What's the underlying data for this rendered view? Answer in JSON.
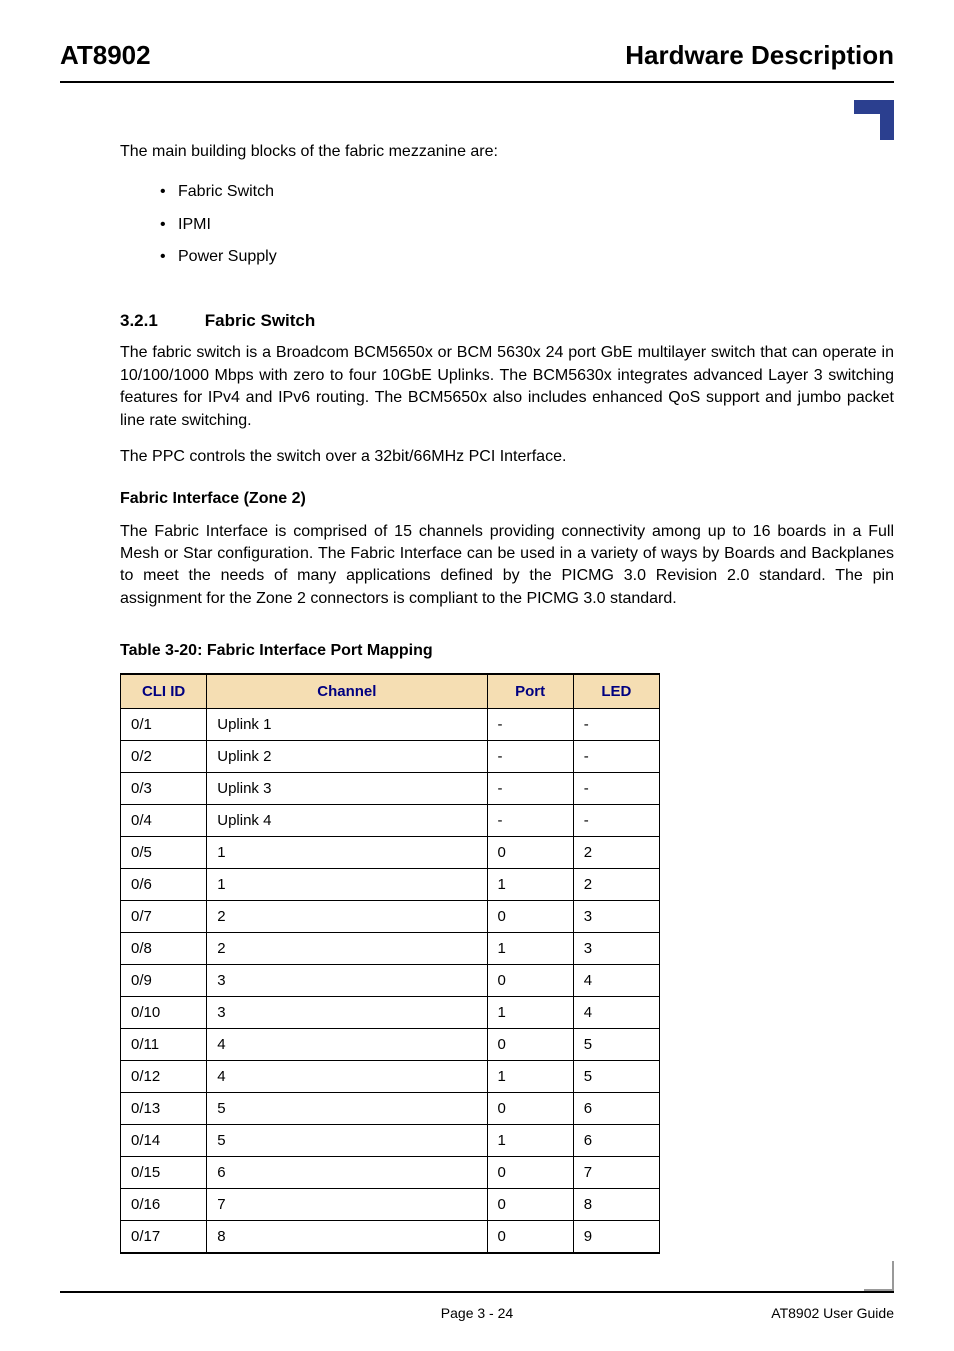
{
  "header": {
    "left": "AT8902",
    "right": "Hardware Description"
  },
  "intro": "The main building blocks of the fabric mezzanine are:",
  "bullets": {
    "b0": "Fabric Switch",
    "b1": "IPMI",
    "b2": "Power Supply"
  },
  "section": {
    "num": "3.2.1",
    "title": "Fabric Switch",
    "p1": "The fabric switch is a Broadcom BCM5650x or BCM 5630x 24 port GbE multilayer switch that can operate in 10/100/1000 Mbps with zero to four 10GbE Uplinks. The BCM5630x integrates advanced Layer 3 switching features for IPv4 and IPv6 routing. The BCM5650x also includes enhanced QoS support and jumbo packet line rate switching.",
    "p2": "The PPC controls the switch over a 32bit/66MHz PCI Interface."
  },
  "subsection": {
    "title": "Fabric Interface (Zone 2)",
    "p1": "The Fabric Interface is comprised of 15 channels providing connectivity among up to 16 boards in a Full Mesh or Star configuration. The Fabric Interface can be used in a variety of ways by Boards and Backplanes to meet the needs of many applications defined by the PICMG 3.0 Revision 2.0 standard. The pin assignment for the Zone 2 connectors is compliant to the PICMG 3.0 standard."
  },
  "table": {
    "caption": "Table 3-20:  Fabric Interface Port Mapping",
    "headers": {
      "h0": "CLI ID",
      "h1": "Channel",
      "h2": "Port",
      "h3": "LED"
    },
    "rows": {
      "r0": {
        "c0": "0/1",
        "c1": "Uplink 1",
        "c2": "-",
        "c3": "-"
      },
      "r1": {
        "c0": "0/2",
        "c1": "Uplink 2",
        "c2": "-",
        "c3": "-"
      },
      "r2": {
        "c0": "0/3",
        "c1": "Uplink 3",
        "c2": "-",
        "c3": "-"
      },
      "r3": {
        "c0": "0/4",
        "c1": "Uplink 4",
        "c2": "-",
        "c3": "-"
      },
      "r4": {
        "c0": "0/5",
        "c1": "1",
        "c2": "0",
        "c3": "2"
      },
      "r5": {
        "c0": "0/6",
        "c1": "1",
        "c2": "1",
        "c3": "2"
      },
      "r6": {
        "c0": "0/7",
        "c1": "2",
        "c2": "0",
        "c3": "3"
      },
      "r7": {
        "c0": "0/8",
        "c1": "2",
        "c2": "1",
        "c3": "3"
      },
      "r8": {
        "c0": "0/9",
        "c1": "3",
        "c2": "0",
        "c3": "4"
      },
      "r9": {
        "c0": "0/10",
        "c1": "3",
        "c2": "1",
        "c3": "4"
      },
      "r10": {
        "c0": "0/11",
        "c1": "4",
        "c2": "0",
        "c3": "5"
      },
      "r11": {
        "c0": "0/12",
        "c1": "4",
        "c2": "1",
        "c3": "5"
      },
      "r12": {
        "c0": "0/13",
        "c1": "5",
        "c2": "0",
        "c3": "6"
      },
      "r13": {
        "c0": "0/14",
        "c1": "5",
        "c2": "1",
        "c3": "6"
      },
      "r14": {
        "c0": "0/15",
        "c1": "6",
        "c2": "0",
        "c3": "7"
      },
      "r15": {
        "c0": "0/16",
        "c1": "7",
        "c2": "0",
        "c3": "8"
      },
      "r16": {
        "c0": "0/17",
        "c1": "8",
        "c2": "0",
        "c3": "9"
      }
    }
  },
  "footer": {
    "center": "Page 3 - 24",
    "right": "AT8902 User Guide"
  }
}
